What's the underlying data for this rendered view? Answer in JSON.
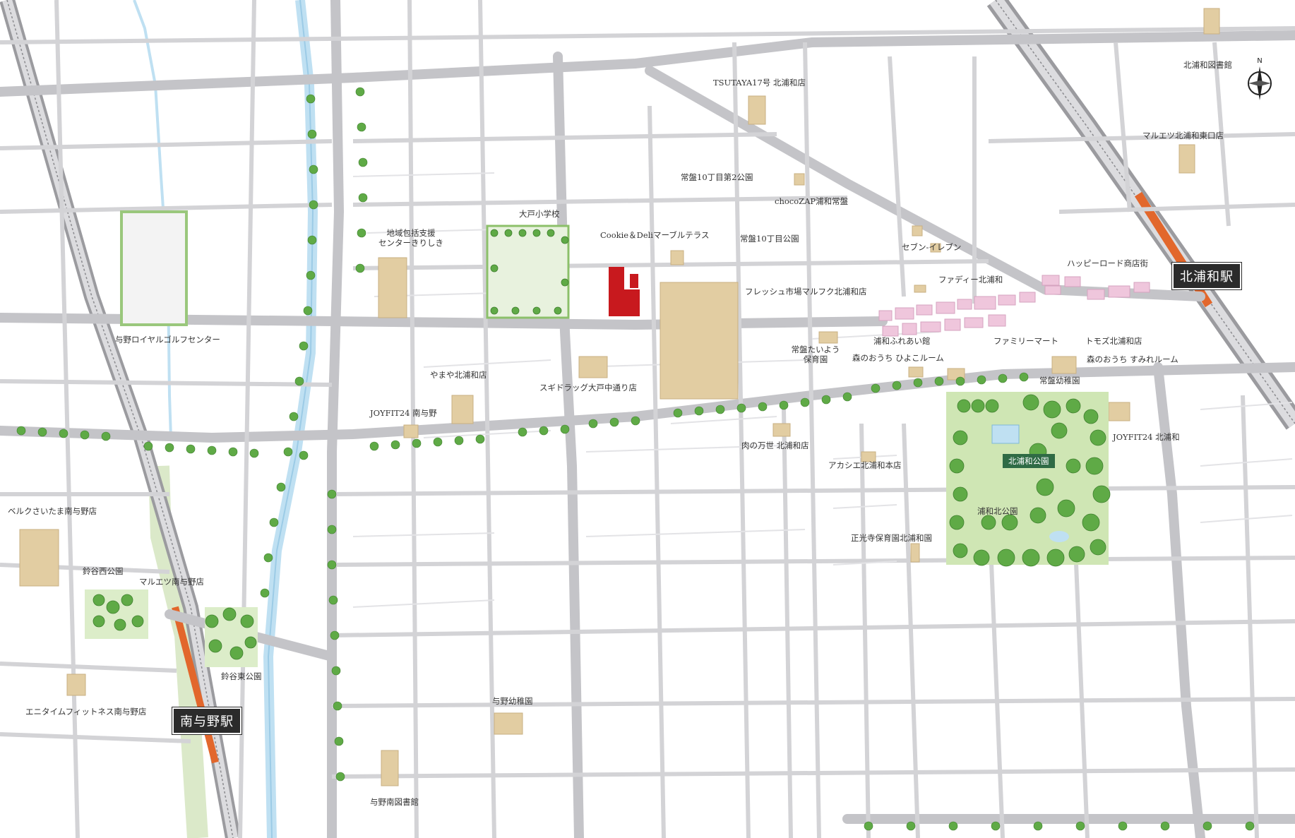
{
  "map_title": "",
  "stations": [
    {
      "id": "kitaurawa",
      "label": "北浦和駅"
    },
    {
      "id": "minamiyono",
      "label": "南与野駅"
    }
  ],
  "parks": [
    {
      "id": "kitaurawa-park",
      "label": "北浦和公園"
    }
  ],
  "compass": {
    "north_label": "N"
  },
  "places": [
    {
      "label": "北浦和図書館"
    },
    {
      "label": "TSUTAYA17号 北浦和店"
    },
    {
      "label": "マルエツ北浦和東口店"
    },
    {
      "label": "常盤10丁目第2公園"
    },
    {
      "label": "chocoZAP浦和常盤"
    },
    {
      "label": "大戸小学校"
    },
    {
      "label": "地域包括支援\nセンターきりしき"
    },
    {
      "label": "Cookie＆Deliマーブルテラス"
    },
    {
      "label": "常盤10丁目公園"
    },
    {
      "label": "セブン-イレブン"
    },
    {
      "label": "ハッピーロード商店街"
    },
    {
      "label": "ファディー北浦和"
    },
    {
      "label": "フレッシュ市場マルフク北浦和店"
    },
    {
      "label": "与野ロイヤルゴルフセンター"
    },
    {
      "label": "浦和ふれあい館"
    },
    {
      "label": "ファミリーマート"
    },
    {
      "label": "トモズ北浦和店"
    },
    {
      "label": "常盤たいよう\n保育園"
    },
    {
      "label": "森のおうち ひよこルーム"
    },
    {
      "label": "森のおうち すみれルーム"
    },
    {
      "label": "やまや北浦和店"
    },
    {
      "label": "スギドラッグ大戸中通り店"
    },
    {
      "label": "常盤幼稚園"
    },
    {
      "label": "JOYFIT24 南与野"
    },
    {
      "label": "JOYFIT24 北浦和"
    },
    {
      "label": "肉の万世 北浦和店"
    },
    {
      "label": "アカシエ北浦和本店"
    },
    {
      "label": "ベルクさいたま南与野店"
    },
    {
      "label": "浦和北公園"
    },
    {
      "label": "正光寺保育園北浦和園"
    },
    {
      "label": "鈴谷西公園"
    },
    {
      "label": "マルエツ南与野店"
    },
    {
      "label": "鈴谷東公園"
    },
    {
      "label": "エニタイムフィットネス南与野店"
    },
    {
      "label": "与野幼稚園"
    },
    {
      "label": "与野南図書館"
    }
  ],
  "colors": {
    "road": "#c9c9cc",
    "road_major": "#b9b9bd",
    "building_tan": "#e2cda2",
    "property_red": "#c8191e",
    "shopping_street_pink": "#efc6dc",
    "tree_green": "#5faa46",
    "park_green": "#cfe6b4",
    "river_blue": "#bfe0f2",
    "rail_orange": "#e2672c",
    "station_label_bg": "#2b2b2b"
  }
}
